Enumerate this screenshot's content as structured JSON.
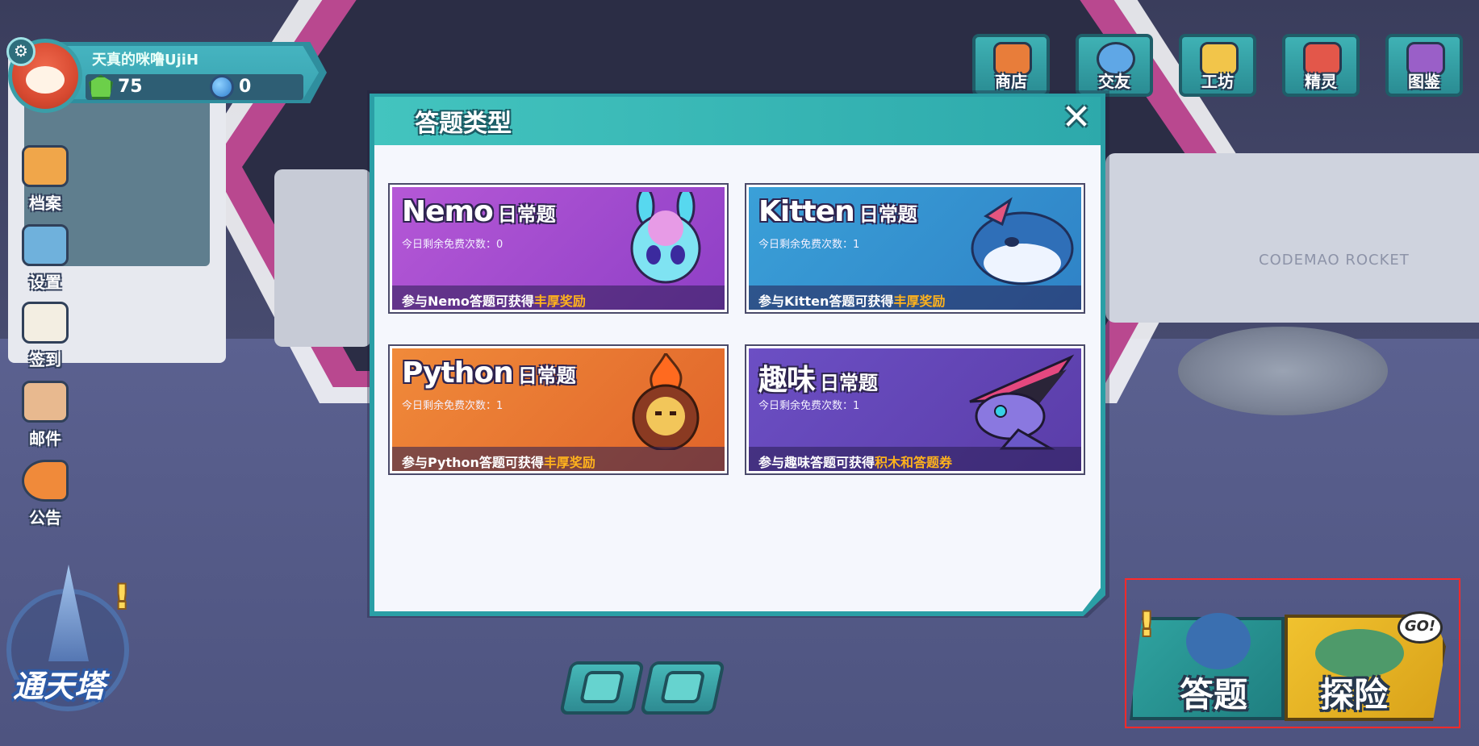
{
  "player": {
    "name": "天真的咪噜UjiH",
    "gems": "75",
    "coins": "0",
    "badge_icon": "gear-icon"
  },
  "side_menu": [
    {
      "label": "档案",
      "icon": "profile-book-icon"
    },
    {
      "label": "设置",
      "icon": "settings-icon"
    },
    {
      "label": "签到",
      "icon": "calendar-checkin-icon"
    },
    {
      "label": "邮件",
      "icon": "mail-icon"
    },
    {
      "label": "公告",
      "icon": "megaphone-icon"
    }
  ],
  "top_menu": [
    {
      "label": "商店",
      "icon": "shop-icon"
    },
    {
      "label": "交友",
      "icon": "chat-bubble-icon"
    },
    {
      "label": "工坊",
      "icon": "tools-icon"
    },
    {
      "label": "精灵",
      "icon": "pet-icon"
    },
    {
      "label": "图鉴",
      "icon": "encyclopedia-icon"
    }
  ],
  "scene": {
    "rocket_text": "CODEMAO ROCKET"
  },
  "tower": {
    "label": "通天塔",
    "alert": "!"
  },
  "actions": {
    "answer_label": "答题",
    "explore_label": "探险",
    "go_badge": "GO!",
    "answer_alert": "!"
  },
  "bottom_buttons": [
    {
      "icon": "add-friend-icon"
    },
    {
      "icon": "switch-cards-icon"
    }
  ],
  "modal": {
    "title": "答题类型",
    "close": "✕",
    "cards": [
      {
        "name": "Nemo",
        "suffix": "日常题",
        "quota": "今日剩余免费次数：0",
        "reward_prefix": "参与Nemo答题可获得",
        "reward_highlight": "丰厚奖励",
        "mascot": "rabbit-mascot-icon"
      },
      {
        "name": "Kitten",
        "suffix": "日常题",
        "quota": "今日剩余免费次数：1",
        "reward_prefix": "参与Kitten答题可获得",
        "reward_highlight": "丰厚奖励",
        "mascot": "whale-mascot-icon"
      },
      {
        "name": "Python",
        "suffix": "日常题",
        "quota": "今日剩余免费次数：1",
        "reward_prefix": "参与Python答题可获得",
        "reward_highlight": "丰厚奖励",
        "mascot": "fire-lion-mascot-icon"
      },
      {
        "name": "趣味",
        "suffix": "日常题",
        "quota": "今日剩余免费次数：1",
        "reward_prefix": "参与趣味答题可获得",
        "reward_highlight": "积木和答题券",
        "mascot": "dragon-mascot-icon"
      }
    ]
  },
  "colors": {
    "accent_teal": "#2a9fa6",
    "reward_orange": "#ffb21c",
    "highlight_red": "#ff2a2a"
  }
}
